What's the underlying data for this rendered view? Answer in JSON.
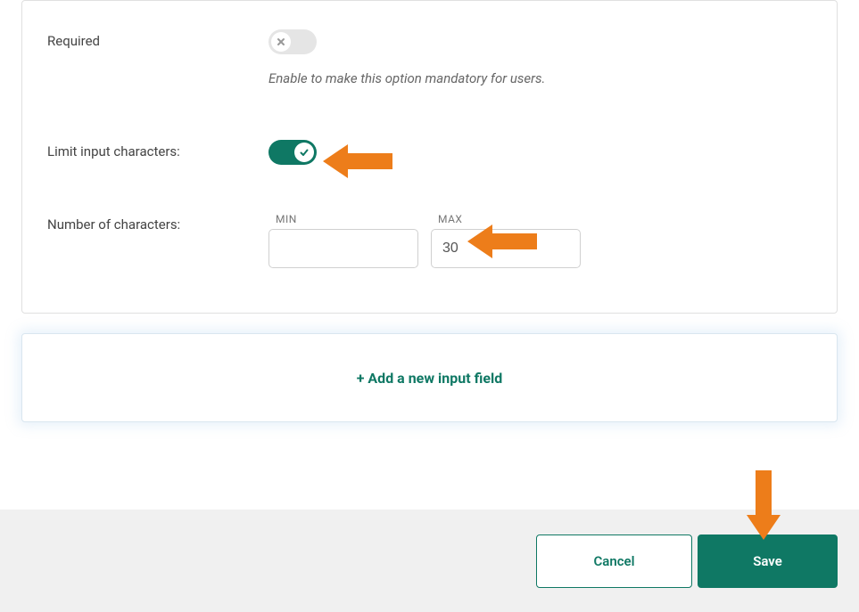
{
  "form": {
    "required": {
      "label": "Required",
      "helper": "Enable to make this option mandatory for users.",
      "value": false
    },
    "limit": {
      "label": "Limit input characters:",
      "value": true
    },
    "chars": {
      "label": "Number of characters:",
      "minLabel": "MIN",
      "maxLabel": "MAX",
      "minValue": "",
      "maxValue": "30"
    }
  },
  "add": {
    "label": "+ Add a new input field"
  },
  "footer": {
    "cancel": "Cancel",
    "save": "Save"
  },
  "colors": {
    "primary": "#0f7864",
    "arrow": "#ed7d1a"
  }
}
